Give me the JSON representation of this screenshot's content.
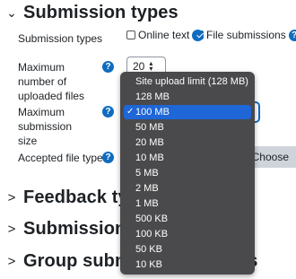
{
  "sections": {
    "submission_types": {
      "title": "Submission types",
      "expanded": true
    },
    "feedback_types": {
      "title": "Feedback types",
      "expanded": false
    },
    "submission_settings": {
      "title": "Submission settings",
      "expanded": false
    },
    "group_submission": {
      "title": "Group submission settings",
      "expanded": false
    }
  },
  "icons": {
    "expanded": "chevron-down-icon",
    "collapsed": "chevron-right-icon",
    "help": "question-circle-icon",
    "check": "checkmark-icon"
  },
  "fields": {
    "submission_types": {
      "label": "Submission types",
      "online_text": {
        "label": "Online text",
        "checked": false
      },
      "file_submissions": {
        "label": "File submissions",
        "checked": true
      }
    },
    "max_files": {
      "label": "Maximum number of uploaded files",
      "value": "20"
    },
    "max_size": {
      "label": "Maximum submission size"
    },
    "accepted_types": {
      "label": "Accepted file types",
      "button": "Choose"
    }
  },
  "dropdown": {
    "selected": "100 MB",
    "options": [
      "Site upload limit (128 MB)",
      "128 MB",
      "100 MB",
      "50 MB",
      "20 MB",
      "10 MB",
      "5 MB",
      "2 MB",
      "1 MB",
      "500 KB",
      "100 KB",
      "50 KB",
      "10 KB"
    ]
  },
  "colors": {
    "accent": "#0f6cbf",
    "dropdown_bg": "#4a4a4c",
    "selection": "#1f66d6"
  }
}
